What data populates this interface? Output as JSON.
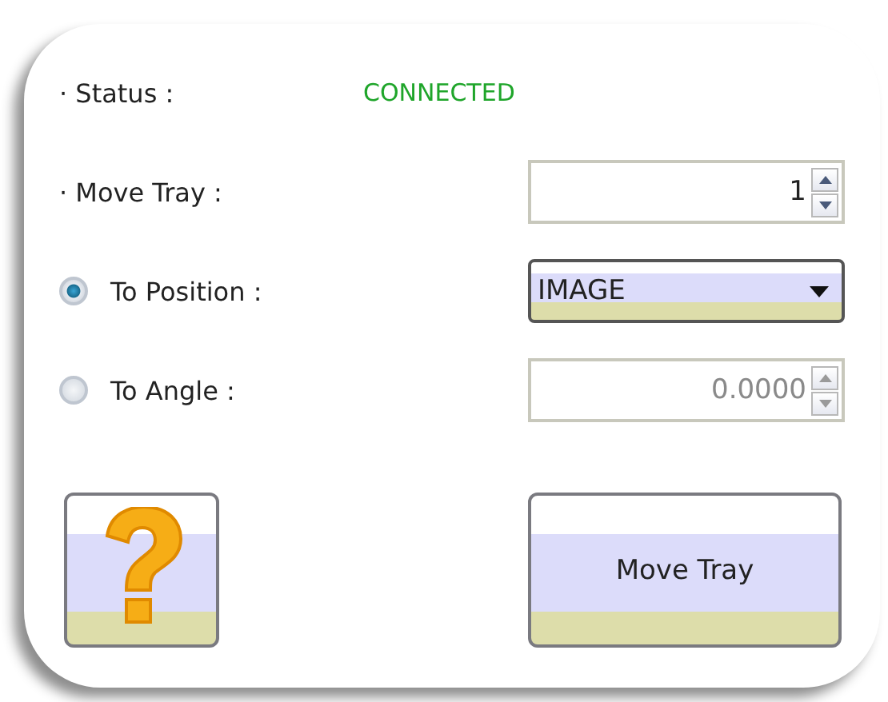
{
  "status": {
    "label": "· Status :",
    "value": "CONNECTED",
    "connected": true
  },
  "move_tray": {
    "label": "· Move Tray :",
    "value": "1"
  },
  "targets": [
    {
      "kind": "dropdown",
      "label": "To Position :",
      "selected": true,
      "value": "IMAGE",
      "disabled": false
    },
    {
      "kind": "spinner",
      "label": "To Angle :",
      "selected": false,
      "value": "0.0000",
      "disabled": true
    }
  ],
  "buttons": [
    {
      "kind": "help"
    },
    {
      "kind": "text",
      "label": "Move Tray"
    }
  ]
}
